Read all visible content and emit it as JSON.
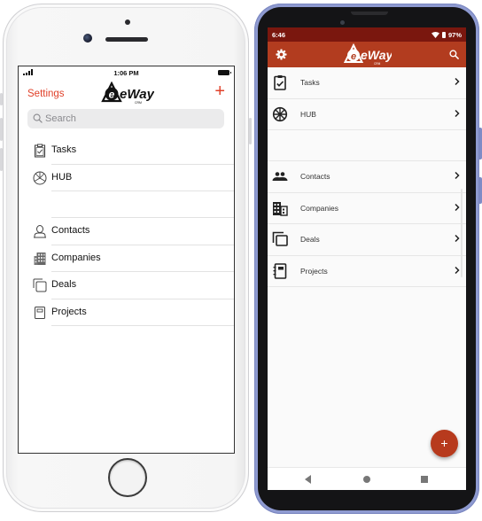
{
  "ios": {
    "status": {
      "time": "1:06 PM"
    },
    "nav": {
      "settings_label": "Settings",
      "logo_text": "eWay",
      "logo_sub": "CRM",
      "add_label": "+"
    },
    "search": {
      "placeholder": "Search",
      "icon": "magnifier-icon"
    },
    "items_group1": [
      {
        "label": "Tasks",
        "icon": "clipboard-check-icon"
      },
      {
        "label": "HUB",
        "icon": "hub-wheel-icon"
      }
    ],
    "items_group2": [
      {
        "label": "Contacts",
        "icon": "person-icon"
      },
      {
        "label": "Companies",
        "icon": "building-icon"
      },
      {
        "label": "Deals",
        "icon": "stacked-squares-icon"
      },
      {
        "label": "Projects",
        "icon": "notebook-icon"
      }
    ]
  },
  "android": {
    "status": {
      "time": "6:46",
      "battery": "97%"
    },
    "appbar": {
      "logo_text": "eWay",
      "logo_sub": "CRM"
    },
    "items_group1": [
      {
        "label": "Tasks",
        "icon": "clipboard-check-icon"
      },
      {
        "label": "HUB",
        "icon": "hub-wheel-icon"
      }
    ],
    "items_group2": [
      {
        "label": "Contacts",
        "icon": "people-icon"
      },
      {
        "label": "Companies",
        "icon": "building-icon"
      },
      {
        "label": "Deals",
        "icon": "stacked-squares-icon"
      },
      {
        "label": "Projects",
        "icon": "notebook-icon"
      }
    ],
    "fab_label": "+"
  },
  "colors": {
    "ios_accent": "#e0412a",
    "android_appbar": "#b23c1f",
    "android_statusbar": "#7a170e",
    "android_fab": "#b73a1d",
    "android_frame": "#8e9ad0"
  }
}
